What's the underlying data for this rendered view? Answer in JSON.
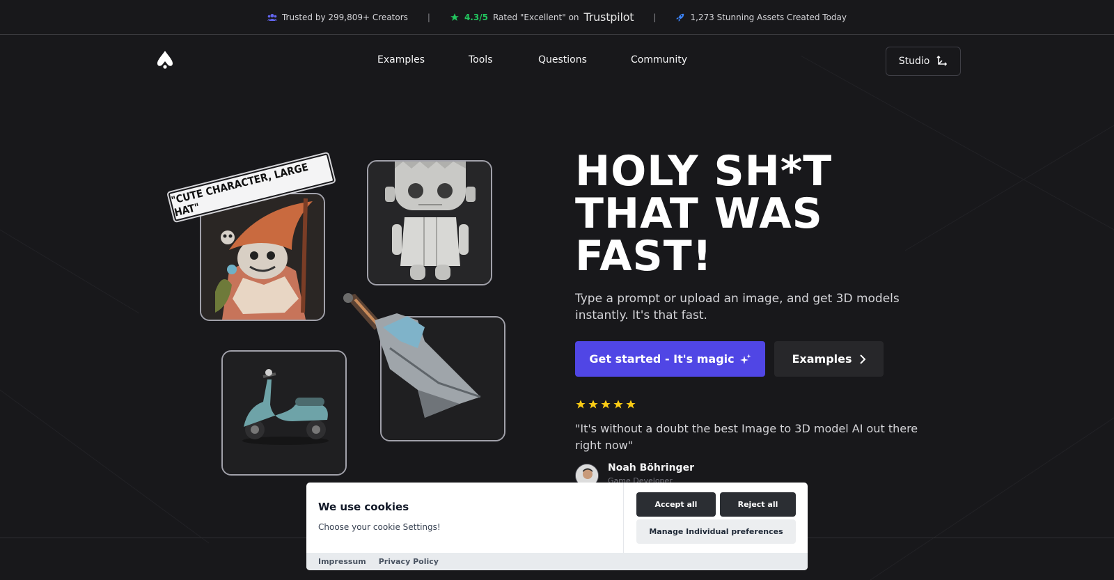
{
  "topbar": {
    "creators_text": "Trusted by 299,809+ Creators",
    "separator": "|",
    "rating_value": "4.3/5",
    "rating_text": "Rated \"Excellent\" on",
    "trustpilot": "Trustpilot",
    "assets_text": "1,273 Stunning Assets Created Today"
  },
  "nav": {
    "items": [
      {
        "label": "Examples"
      },
      {
        "label": "Tools"
      },
      {
        "label": "Questions"
      },
      {
        "label": "Community"
      }
    ],
    "studio_label": "Studio"
  },
  "gallery": {
    "tag_text": "\"CUTE CHARACTER, LARGE HAT\""
  },
  "hero": {
    "headline_line1": "HOLY SH*T",
    "headline_line2": "THAT WAS",
    "headline_line3": "FAST!",
    "subtitle": "Type a prompt or upload an image, and get 3D models instantly. It's that fast.",
    "cta_primary": "Get started - It's magic",
    "cta_secondary": "Examples",
    "rating_stars": 5,
    "quote": "\"It's without a doubt the best Image to 3D model AI out there right now\"",
    "author_name": "Noah Böhringer",
    "author_role": "Game Developer"
  },
  "cookie": {
    "title": "We use cookies",
    "description": "Choose your cookie Settings!",
    "accept_label": "Accept all",
    "reject_label": "Reject all",
    "manage_label": "Manage Individual preferences",
    "impressum_label": "Impressum",
    "privacy_label": "Privacy Policy"
  },
  "colors": {
    "background": "#18181b",
    "accent": "#5046e5",
    "rating_green": "#22c55e",
    "star_yellow": "#facc15"
  },
  "icons": {
    "creators": "users-icon",
    "rating": "star-icon",
    "assets": "rocket-icon",
    "studio": "axis-arrows-icon",
    "cta_primary": "sparkles-icon",
    "cta_secondary": "chevron-right-icon"
  }
}
